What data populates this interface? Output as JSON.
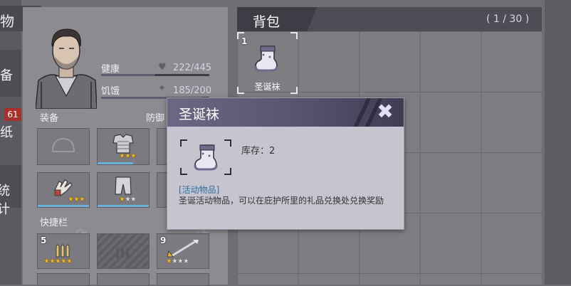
{
  "left_menu": {
    "title_partial": "物",
    "tab_equip_partial": "备",
    "red_badge": "61",
    "tab_paper_partial": "纸",
    "tab_stats_partial": "统计"
  },
  "character": {
    "health_label": "健康",
    "health_value": "222/445",
    "health_ratio": 0.5,
    "hunger_label": "饥饿",
    "hunger_value": "185/200",
    "hunger_ratio": 0.925,
    "equip_label": "装备",
    "defense_label_partial": "防御",
    "quickbar_label": "快捷栏"
  },
  "equipment": [
    {
      "icon": "helmet-icon",
      "stars": 0,
      "max_stars": 0
    },
    {
      "icon": "armor-vest-icon",
      "stars": 3,
      "max_stars": 3
    },
    {
      "icon": "gloves-icon",
      "stars": 3,
      "max_stars": 3
    },
    {
      "icon": "pants-icon",
      "stars": 1,
      "max_stars": 3
    }
  ],
  "quickbar": [
    {
      "count": "5",
      "icon": "bullets-icon",
      "stars": 5,
      "max_stars": 5
    },
    {
      "count": "",
      "icon": "bullets-icon",
      "stars": 0,
      "max_stars": 0
    },
    {
      "count": "9",
      "icon": "spear-icon",
      "stars": 1,
      "max_stars": 4
    }
  ],
  "backpack": {
    "title": "背包",
    "capacity": "( 1 / 30 )",
    "items": [
      {
        "count": "1",
        "name": "圣诞袜",
        "icon": "christmas-stocking-icon"
      }
    ]
  },
  "tooltip": {
    "title": "圣诞袜",
    "stock": "库存：2",
    "tag": "[活动物品]",
    "description": "圣诞活动物品，可以在庇护所里的礼品兑换处兑换奖励",
    "close_icon": "close-icon"
  },
  "colors": {
    "star_on": "#f2b31f",
    "tag_blue": "#2d6ea0",
    "badge_red": "#a8302b"
  }
}
